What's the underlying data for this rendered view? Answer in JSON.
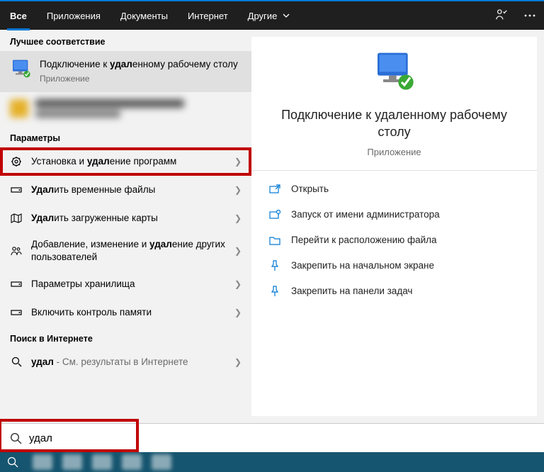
{
  "tabs": {
    "all": "Все",
    "apps": "Приложения",
    "docs": "Документы",
    "internet": "Интернет",
    "other": "Другие"
  },
  "sections": {
    "best_match": "Лучшее соответствие",
    "settings": "Параметры",
    "web": "Поиск в Интернете"
  },
  "best_match": {
    "title_pre": "Подключение к ",
    "title_bold": "удал",
    "title_post": "енному рабочему столу",
    "subtitle": "Приложение"
  },
  "settings": [
    {
      "pre": "Установка и ",
      "bold": "удал",
      "post": "ение программ"
    },
    {
      "pre": "",
      "bold": "Удал",
      "post": "ить временные файлы"
    },
    {
      "pre": "",
      "bold": "Удал",
      "post": "ить загруженные карты"
    },
    {
      "pre": "Добавление, изменение и ",
      "bold": "удал",
      "post": "ение других пользователей"
    },
    {
      "pre": "Параметры хранилища",
      "bold": "",
      "post": ""
    },
    {
      "pre": "Включить контроль памяти",
      "bold": "",
      "post": ""
    }
  ],
  "web": {
    "query_bold": "удал",
    "query_post": " - См. результаты в Интернете"
  },
  "preview": {
    "title": "Подключение к удаленному рабочему столу",
    "subtitle": "Приложение",
    "actions": {
      "open": "Открыть",
      "run_admin": "Запуск от имени администратора",
      "open_location": "Перейти к расположению файла",
      "pin_start": "Закрепить на начальном экране",
      "pin_taskbar": "Закрепить на панели задач"
    }
  },
  "search": {
    "value": "удал"
  }
}
